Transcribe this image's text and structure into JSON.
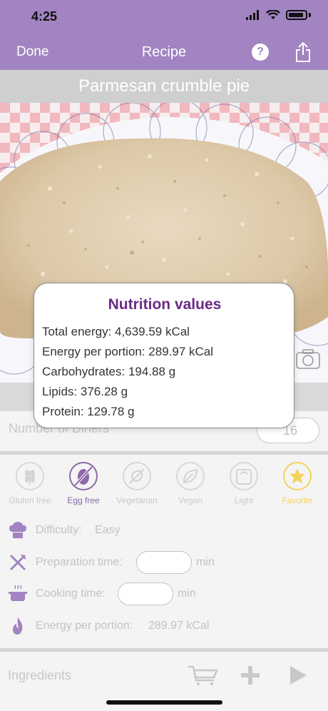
{
  "status_bar": {
    "time": "4:25",
    "icons": [
      "signal-icon",
      "wifi-icon",
      "battery-icon"
    ]
  },
  "nav": {
    "done_label": "Done",
    "title": "Recipe",
    "help_label": "?",
    "share_icon": "share-icon"
  },
  "recipe": {
    "name": "Parmesan crumble pie"
  },
  "diners": {
    "label": "Number of Diners",
    "value": "16"
  },
  "diets": [
    {
      "label": "Gluten free",
      "icon": "wheat-icon",
      "active": false
    },
    {
      "label": "Egg free",
      "icon": "egg-crossed-icon",
      "active": true
    },
    {
      "label": "Vegetarian",
      "icon": "no-meat-icon",
      "active": false
    },
    {
      "label": "Vegan",
      "icon": "leaf-icon",
      "active": false
    },
    {
      "label": "Light",
      "icon": "scale-icon",
      "active": false
    },
    {
      "label": "Favorite",
      "icon": "star-icon",
      "active": false
    }
  ],
  "details": {
    "difficulty_label": "Difficulty:",
    "difficulty_value": "Easy",
    "prep_label": "Preparation time:",
    "prep_value": "",
    "prep_unit": "min",
    "cooking_label": "Cooking time:",
    "cooking_value": "",
    "cooking_unit": "min",
    "energy_label": "Energy per portion:",
    "energy_value": "289.97 kCal"
  },
  "ingredients": {
    "label": "Ingredients",
    "icons": [
      "cart-icon",
      "plus-icon",
      "play-icon"
    ]
  },
  "nutrition": {
    "title": "Nutrition values",
    "lines": [
      "Total energy: 4,639.59 kCal",
      "Energy per portion: 289.97 kCal",
      "Carbohydrates: 194.88 g",
      "Lipids: 376.28 g",
      "Protein: 129.78 g"
    ]
  },
  "colors": {
    "header": "#a184c1",
    "accent_purple": "#6a2a86",
    "favorite_yellow": "#f5d25a",
    "egg_active": "#8a6aa8"
  }
}
